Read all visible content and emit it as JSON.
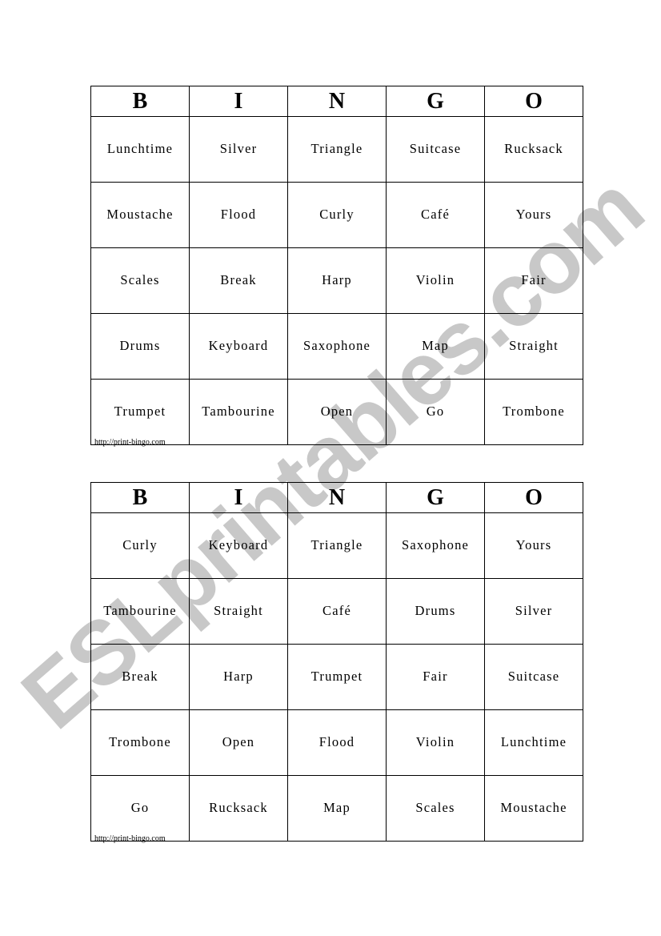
{
  "watermark": "ESLprintables.com",
  "cards": [
    {
      "header": [
        "B",
        "I",
        "N",
        "G",
        "O"
      ],
      "rows": [
        [
          "Lunchtime",
          "Silver",
          "Triangle",
          "Suitcase",
          "Rucksack"
        ],
        [
          "Moustache",
          "Flood",
          "Curly",
          "Café",
          "Yours"
        ],
        [
          "Scales",
          "Break",
          "Harp",
          "Violin",
          "Fair"
        ],
        [
          "Drums",
          "Keyboard",
          "Saxophone",
          "Map",
          "Straight"
        ],
        [
          "Trumpet",
          "Tambourine",
          "Open",
          "Go",
          "Trombone"
        ]
      ],
      "credit": "http://print-bingo.com"
    },
    {
      "header": [
        "B",
        "I",
        "N",
        "G",
        "O"
      ],
      "rows": [
        [
          "Curly",
          "Keyboard",
          "Triangle",
          "Saxophone",
          "Yours"
        ],
        [
          "Tambourine",
          "Straight",
          "Café",
          "Drums",
          "Silver"
        ],
        [
          "Break",
          "Harp",
          "Trumpet",
          "Fair",
          "Suitcase"
        ],
        [
          "Trombone",
          "Open",
          "Flood",
          "Violin",
          "Lunchtime"
        ],
        [
          "Go",
          "Rucksack",
          "Map",
          "Scales",
          "Moustache"
        ]
      ],
      "credit": "http://print-bingo.com"
    }
  ]
}
